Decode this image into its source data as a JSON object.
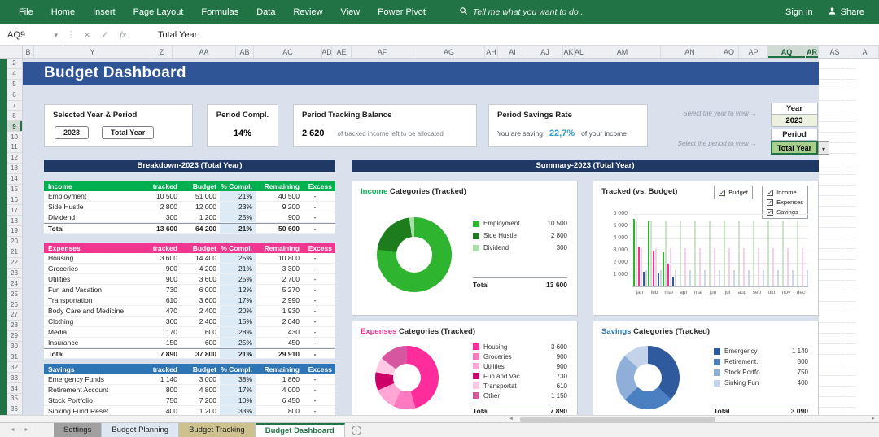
{
  "ribbon": {
    "tabs": [
      "File",
      "Home",
      "Insert",
      "Page Layout",
      "Formulas",
      "Data",
      "Review",
      "View",
      "Power Pivot"
    ],
    "search_placeholder": "Tell me what you want to do...",
    "sign_in_label": "Sign in",
    "share_label": "Share"
  },
  "formula_bar": {
    "cell_reference": "AQ9",
    "formula_value": "Total Year"
  },
  "grid": {
    "column_headers": [
      "B",
      "Y",
      "Z",
      "AA",
      "AB",
      "AC",
      "AD",
      "AE",
      "AF",
      "AG",
      "AH",
      "AI",
      "AJ",
      "AK",
      "AL",
      "AM",
      "AN",
      "AO",
      "AP",
      "AQ",
      "AR",
      "AS",
      "A"
    ],
    "selected_columns": [
      "AQ",
      "AR"
    ],
    "row_headers": [
      "2",
      "4",
      "5",
      "6",
      "7",
      "8",
      "9",
      "10",
      "11",
      "12",
      "13",
      "14",
      "15",
      "16",
      "17",
      "18",
      "19",
      "20",
      "21",
      "22",
      "23",
      "24",
      "25",
      "26",
      "27",
      "28",
      "29",
      "30",
      "31",
      "32",
      "33",
      "34",
      "35",
      "36"
    ],
    "selected_row": "9"
  },
  "dashboard": {
    "title": "Budget Dashboard",
    "cards": {
      "year_period": {
        "title": "Selected Year & Period",
        "year": "2023",
        "period": "Total Year"
      },
      "period_compl": {
        "title": "Period Compl.",
        "value": "14%"
      },
      "tracking_balance": {
        "title": "Period Tracking Balance",
        "value": "2 620",
        "caption": "of tracked income left to be allocated"
      },
      "savings_rate": {
        "title": "Period Savings Rate",
        "prefix": "You are saving",
        "value": "22,7%",
        "suffix": "of your income"
      }
    },
    "selectors": {
      "year_hint": "Select the year to view →",
      "period_hint": "Select the period to view →",
      "year_label": "Year",
      "year_value": "2023",
      "period_label": "Period",
      "period_value": "Total Year"
    },
    "breakdown": {
      "title": "Breakdown-2023 (Total Year)",
      "columns": [
        "tracked",
        "Budget",
        "% Compl.",
        "Remaining",
        "Excess"
      ],
      "sections": [
        {
          "name": "Income",
          "color": "#00B050",
          "rows": [
            [
              "Employment",
              "10 500",
              "51 000",
              "21%",
              "40 500",
              "-"
            ],
            [
              "Side Hustle",
              "2 800",
              "12 000",
              "23%",
              "9 200",
              "-"
            ],
            [
              "Dividend",
              "300",
              "1 200",
              "25%",
              "900",
              "-"
            ]
          ],
          "total": [
            "Total",
            "13 600",
            "64 200",
            "21%",
            "50 600",
            "-"
          ]
        },
        {
          "name": "Expenses",
          "color": "#F0368F",
          "rows": [
            [
              "Housing",
              "3 600",
              "14 400",
              "25%",
              "10 800",
              "-"
            ],
            [
              "Groceries",
              "900",
              "4 200",
              "21%",
              "3 300",
              "-"
            ],
            [
              "Utilities",
              "900",
              "3 600",
              "25%",
              "2 700",
              "-"
            ],
            [
              "Fun and Vacation",
              "730",
              "6 000",
              "12%",
              "5 270",
              "-"
            ],
            [
              "Transportation",
              "610",
              "3 600",
              "17%",
              "2 990",
              "-"
            ],
            [
              "Body Care and Medicine",
              "470",
              "2 400",
              "20%",
              "1 930",
              "-"
            ],
            [
              "Clothing",
              "360",
              "2 400",
              "15%",
              "2 040",
              "-"
            ],
            [
              "Media",
              "170",
              "600",
              "28%",
              "430",
              "-"
            ],
            [
              "Insurance",
              "150",
              "600",
              "25%",
              "450",
              "-"
            ]
          ],
          "total": [
            "Total",
            "7 890",
            "37 800",
            "21%",
            "29 910",
            "-"
          ]
        },
        {
          "name": "Savings",
          "color": "#2E75B6",
          "rows": [
            [
              "Emergency Funds",
              "1 140",
              "3 000",
              "38%",
              "1 860",
              "-"
            ],
            [
              "Retirement Account",
              "800",
              "4 800",
              "17%",
              "4 000",
              "-"
            ],
            [
              "Stock Portfolio",
              "750",
              "7 200",
              "10%",
              "6 450",
              "-"
            ],
            [
              "Sinking Fund Reset",
              "400",
              "1 200",
              "33%",
              "800",
              "-"
            ]
          ],
          "total": null
        }
      ]
    },
    "summary_title": "Summary-2023 (Total Year)"
  },
  "chart_data": [
    {
      "type": "pie",
      "title_accent": "Income",
      "accent_color": "#00B050",
      "title_rest": " Categories (Tracked)",
      "labels": [
        "Employment",
        "Side Hustle",
        "Dividend"
      ],
      "values": [
        10500,
        2800,
        300
      ],
      "display_values": [
        "10 500",
        "2 800",
        "300"
      ],
      "colors": [
        "#2fb42f",
        "#1d7d1d",
        "#a8e0a8"
      ],
      "total_label": "Total",
      "total": "13 600",
      "legend_position": "right"
    },
    {
      "type": "bar",
      "title": "Tracked (vs. Budget)",
      "legend": [
        "Budget",
        "Income",
        "Expenses",
        "Savings"
      ],
      "x": [
        "jan",
        "feb",
        "mar",
        "apr",
        "maj",
        "jun",
        "jul",
        "aug",
        "sep",
        "okt",
        "nov",
        "dec"
      ],
      "ylim": [
        0,
        6000
      ],
      "yticks": [
        "6 000",
        "5 000",
        "4 000",
        "3 000",
        "2 000",
        "1 000"
      ],
      "grid": true,
      "series": [
        {
          "name": "Income (tracked)",
          "color": "#2fb42f",
          "values": [
            5500,
            5300,
            2800,
            0,
            0,
            0,
            0,
            0,
            0,
            0,
            0,
            0
          ]
        },
        {
          "name": "Income (budget)",
          "color": "#c9e7c4",
          "values": [
            5350,
            5350,
            5350,
            5350,
            5350,
            5350,
            5350,
            5350,
            5350,
            5350,
            5350,
            5350
          ]
        },
        {
          "name": "Expenses (tracked)",
          "color": "#ff2d9b",
          "values": [
            3200,
            2900,
            1790,
            0,
            0,
            0,
            0,
            0,
            0,
            0,
            0,
            0
          ]
        },
        {
          "name": "Expenses (budget)",
          "color": "#f9cfe6",
          "values": [
            3150,
            3150,
            3150,
            3150,
            3150,
            3150,
            3150,
            3150,
            3150,
            3150,
            3150,
            3150
          ]
        },
        {
          "name": "Savings (tracked)",
          "color": "#2f5b9e",
          "values": [
            1200,
            1090,
            800,
            0,
            0,
            0,
            0,
            0,
            0,
            0,
            0,
            0
          ]
        },
        {
          "name": "Savings (budget)",
          "color": "#ccd9ec",
          "values": [
            1350,
            1350,
            1350,
            1350,
            1350,
            1350,
            1350,
            1350,
            1350,
            1350,
            1350,
            1350
          ]
        }
      ]
    },
    {
      "type": "pie",
      "title_accent": "Expenses",
      "accent_color": "#F0368F",
      "title_rest": " Categories (Tracked)",
      "labels": [
        "Housing",
        "Groceries",
        "Utilities",
        "Fun and Vac",
        "Transportat",
        "Other"
      ],
      "values": [
        3600,
        900,
        900,
        730,
        610,
        1150
      ],
      "display_values": [
        "3 600",
        "900",
        "900",
        "730",
        "610",
        "1 150"
      ],
      "colors": [
        "#ff2d9b",
        "#ff79c1",
        "#ffa6d5",
        "#cc0066",
        "#ffc9e5",
        "#d6569f"
      ],
      "total_label": "Total",
      "total": "7 890",
      "legend_position": "right"
    },
    {
      "type": "pie",
      "title_accent": "Savings",
      "accent_color": "#2E75B6",
      "title_rest": " Categories (Tracked)",
      "labels": [
        "Emergency",
        "Retirement.",
        "Stock Portfo",
        "Sinking Fun"
      ],
      "values": [
        1140,
        800,
        750,
        400
      ],
      "display_values": [
        "1 140",
        "800",
        "750",
        "400"
      ],
      "colors": [
        "#2f5b9e",
        "#4a7fc1",
        "#8fafd9",
        "#c3d4ea"
      ],
      "total_label": "Total",
      "total": "3 090",
      "legend_position": "right"
    }
  ],
  "sheet_tabs": [
    {
      "label": "Settings",
      "color": "#a0a0a0",
      "text_color": "#1f1f1f",
      "active": false
    },
    {
      "label": "Budget Planning",
      "color": "#dde7f2",
      "text_color": "#1f1f1f",
      "active": false
    },
    {
      "label": "Budget Tracking",
      "color": "#cdc28e",
      "text_color": "#1f1f1f",
      "active": false
    },
    {
      "label": "Budget Dashboard",
      "color": "#ffffff",
      "text_color": "#217346",
      "active": true
    }
  ],
  "icons": {
    "search-icon": "magnifier",
    "share-icon": "person",
    "namebox-caret-icon": "▾",
    "separator-dots-icon": "⋮",
    "cancel-icon": "×",
    "enter-icon": "✓",
    "fx-icon": "fx",
    "period-dropdown-icon": "▾",
    "checkbox-icon": "checked-box",
    "new-sheet-icon": "+",
    "scroll-left-icon": "◄",
    "scroll-right-icon": "►"
  },
  "colors": {
    "ribbon_green": "#217346",
    "title_blue": "#2F5597",
    "band_navy": "#1F3864",
    "income_green": "#00B050",
    "expenses_pink": "#F0368F",
    "savings_blue": "#2E75B6",
    "savings_rate_teal": "#2E9BC6"
  }
}
